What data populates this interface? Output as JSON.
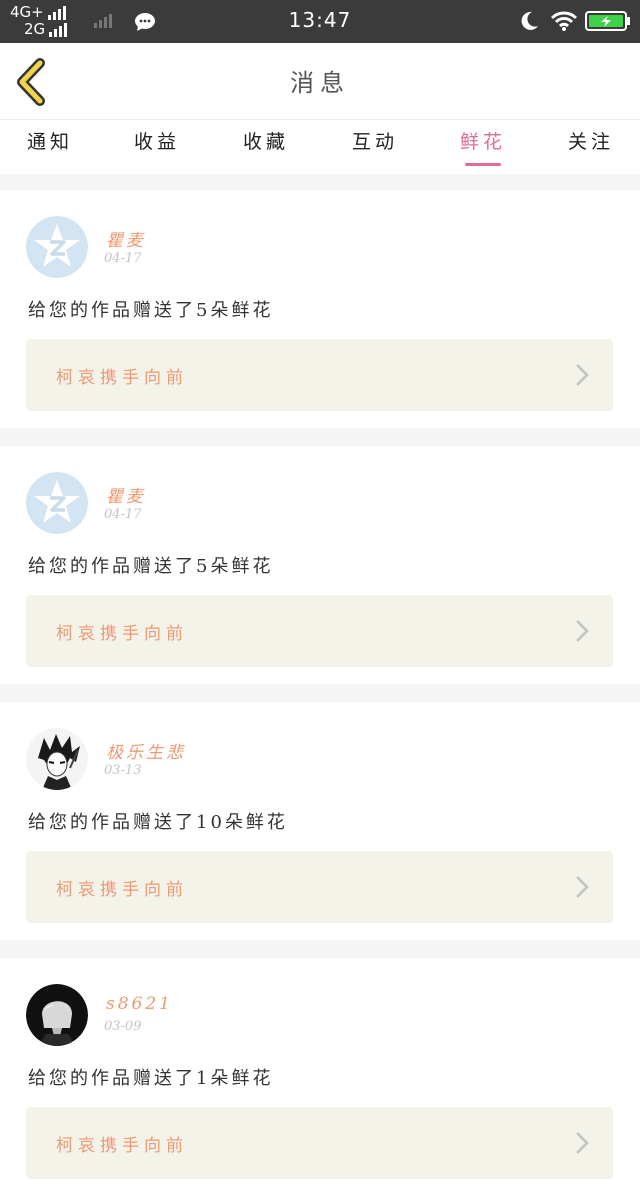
{
  "status_bar": {
    "network_top": "4G+",
    "network_bottom": "2G",
    "time": "13:47",
    "icons": [
      "signal-icon",
      "chat-icon",
      "moon-icon",
      "wifi-icon",
      "battery-charging-icon"
    ]
  },
  "header": {
    "title": "消息",
    "back_icon": "chevron-left-icon"
  },
  "tabs": [
    {
      "label": "通知",
      "active": false
    },
    {
      "label": "收益",
      "active": false
    },
    {
      "label": "收藏",
      "active": false
    },
    {
      "label": "互动",
      "active": false
    },
    {
      "label": "鲜花",
      "active": true
    },
    {
      "label": "关注",
      "active": false
    }
  ],
  "notifications": [
    {
      "username": "瞿麦",
      "date": "04-17",
      "message": "给您的作品赠送了5朵鲜花",
      "work_title": "柯哀携手向前",
      "avatar": "default-star-avatar"
    },
    {
      "username": "瞿麦",
      "date": "04-17",
      "message": "给您的作品赠送了5朵鲜花",
      "work_title": "柯哀携手向前",
      "avatar": "default-star-avatar"
    },
    {
      "username": "极乐生悲",
      "date": "03-13",
      "message": "给您的作品赠送了10朵鲜花",
      "work_title": "柯哀携手向前",
      "avatar": "anime-boy-avatar"
    },
    {
      "username": "s8621",
      "date": "03-09",
      "message": "给您的作品赠送了1朵鲜花",
      "work_title": "柯哀携手向前",
      "avatar": "dark-portrait-avatar"
    }
  ],
  "colors": {
    "accent_pink": "#e06b96",
    "username_orange": "#ef9a70",
    "status_bar": "#3b3b3b",
    "link_box": "#f3f3ea"
  }
}
